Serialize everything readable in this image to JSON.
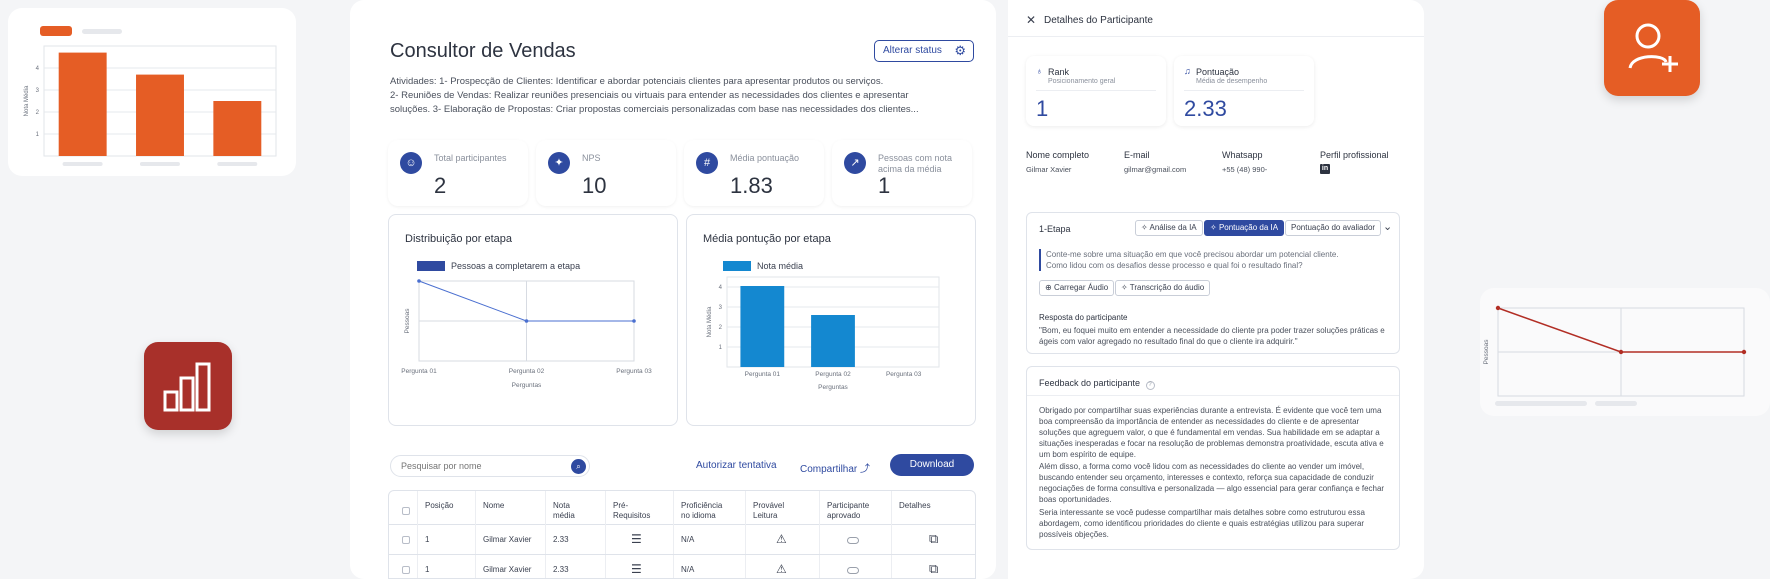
{
  "colors": {
    "accent": "#2f4aa0",
    "orange": "#e55d25",
    "red": "#a8302a",
    "bar_blue": "#1488d0",
    "line_blue": "#4a6fd0",
    "line_red": "#b22e25"
  },
  "icons": {
    "profile": "user-plus-icon",
    "stats": "bar-chart-icon"
  },
  "deco_left_chart": {
    "ylabel": "Nota Média",
    "yticks": [
      "4",
      "3",
      "2",
      "1"
    ],
    "chart_data": {
      "type": "bar",
      "categories": [
        "",
        "",
        ""
      ],
      "values": [
        4.7,
        3.7,
        2.5
      ],
      "ylim": [
        0,
        5
      ]
    }
  },
  "deco_right_chart": {
    "ylabel": "Pessoas",
    "chart_data": {
      "type": "line",
      "x": [
        0,
        1,
        2
      ],
      "values": [
        1,
        0,
        0
      ],
      "ylim": [
        -1,
        1
      ]
    }
  },
  "main": {
    "title": "Consultor de Vendas",
    "status_button": "Alterar status",
    "description": [
      "Atividades: 1- Prospecção de Clientes: Identificar e abordar potenciais clientes para apresentar produtos ou serviços.",
      "2- Reuniões de Vendas: Realizar reuniões presenciais ou virtuais para entender as necessidades dos clientes e apresentar",
      "soluções. 3- Elaboração de Propostas: Criar propostas comerciais personalizadas com base nas necessidades dos clientes..."
    ],
    "stats": [
      {
        "label": "Total participantes",
        "value": "2",
        "icon": "users-icon",
        "glyph": "☺"
      },
      {
        "label": "NPS",
        "value": "10",
        "icon": "sparkle-icon",
        "glyph": "✦"
      },
      {
        "label": "Média pontuação",
        "value": "1.83",
        "icon": "hash-icon",
        "glyph": "#"
      },
      {
        "label": "Pessoas com nota acima da média",
        "value": "1",
        "icon": "trend-up-icon",
        "glyph": "↗"
      }
    ],
    "chart1": {
      "title": "Distribuição por etapa",
      "legend": "Pessoas a completarem a etapa",
      "xlabel": "Perguntas",
      "ylabel": "Pessoas",
      "chart_data": {
        "type": "line",
        "categories": [
          "Pergunta 01",
          "Pergunta 02",
          "Pergunta 03"
        ],
        "values": [
          1,
          0,
          0
        ],
        "ylim": [
          -1,
          1
        ],
        "series": [
          {
            "name": "Pessoas a completarem a etapa",
            "values": [
              1,
              0,
              0
            ]
          }
        ]
      }
    },
    "chart2": {
      "title": "Média pontução por etapa",
      "legend": "Nota média",
      "xlabel": "Perguntas",
      "ylabel": "Nota Média",
      "yticks": [
        "4",
        "3",
        "2",
        "1"
      ],
      "chart_data": {
        "type": "bar",
        "categories": [
          "Pergunta 01",
          "Pergunta 02",
          "Pergunta 03"
        ],
        "values": [
          4.05,
          2.6,
          0
        ],
        "ylim": [
          0,
          4.5
        ],
        "series": [
          {
            "name": "Nota média",
            "values": [
              4.05,
              2.6,
              0
            ]
          }
        ]
      }
    },
    "search_placeholder": "Pesquisar por nome",
    "authorize_link": "Autorizar tentativa",
    "share_link": "Compartilhar",
    "download_button": "Download",
    "table": {
      "headers": [
        "Posição",
        "Nome",
        "Nota média",
        "Pré-Requisitos",
        "Proficiência no idioma",
        "Provável Leitura",
        "Participante aprovado",
        "Detalhes"
      ],
      "rows": [
        {
          "pos": "1",
          "name": "Gilmar Xavier",
          "score": "2.33",
          "prof": "N/A"
        },
        {
          "pos": "1",
          "name": "Gilmar Xavier",
          "score": "2.33",
          "prof": "N/A"
        }
      ]
    }
  },
  "details": {
    "title": "Detalhes do Participante",
    "rank_label": "Rank",
    "rank_sub": "Posicionamento geral",
    "rank_value": "1",
    "score_label": "Pontuação",
    "score_sub": "Média de desempenho",
    "score_value": "2.33",
    "fields": [
      {
        "label": "Nome completo",
        "value": "Gilmar Xavier"
      },
      {
        "label": "E-mail",
        "value": "gilmar@gmail.com"
      },
      {
        "label": "Whatsapp",
        "value": "+55 (48) 990-"
      },
      {
        "label": "Perfil profissional",
        "value": ""
      }
    ],
    "stage": {
      "title": "1-Etapa",
      "tabs": [
        "Análise da IA",
        "Pontuação da IA",
        "Pontuação do avaliador"
      ],
      "question": "Conte-me sobre uma situação em que você precisou abordar um potencial cliente. Como lidou com os desafios desse processo e qual foi o resultado final?",
      "load_audio": "Carregar Áudio",
      "transcription": "Transcrição do áudio",
      "answer_label": "Resposta do participante",
      "answer": "\"Bom, eu foquei muito em entender a necessidade do cliente pra poder trazer soluções práticas e ágeis com valor agregado no resultado final do que o cliente ira adquirir.\""
    },
    "feedback": {
      "title": "Feedback do participante",
      "p1": "Obrigado por compartilhar suas experiências durante a entrevista. É evidente que você tem uma boa compreensão da importância de entender as necessidades do cliente e de apresentar soluções que agreguem valor, o que é fundamental em vendas. Sua habilidade em se adaptar a situações inesperadas e focar na resolução de problemas demonstra proatividade, escuta ativa e um bom espírito de equipe.",
      "p2": "Além disso, a forma como você lidou com as necessidades do cliente ao vender um imóvel, buscando entender seu orçamento, interesses e contexto, reforça sua capacidade de conduzir negociações de forma consultiva e personalizada — algo essencial para gerar confiança e fechar boas oportunidades.",
      "p3": "Seria interessante se você pudesse compartilhar mais detalhes sobre como estruturou essa abordagem, como identificou prioridades do cliente e quais estratégias utilizou para superar possíveis objeções."
    }
  }
}
